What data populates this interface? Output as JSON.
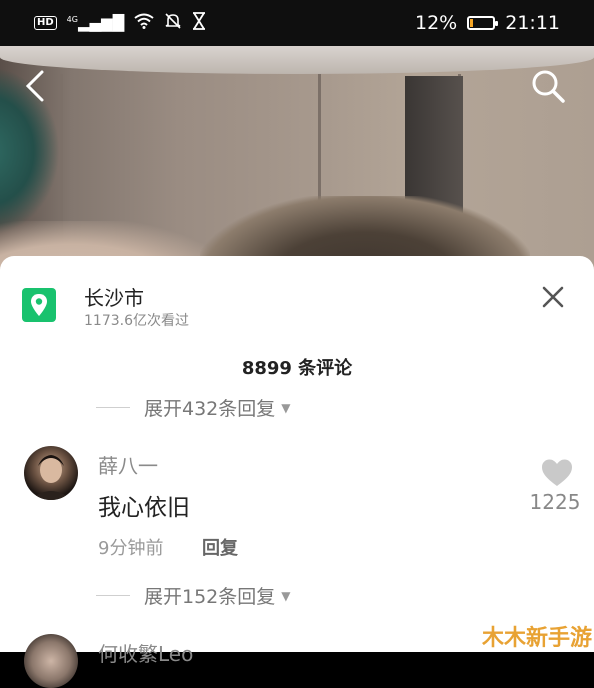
{
  "status_bar": {
    "hd": "HD",
    "network": "4G",
    "battery_percent_text": "12%",
    "battery_level": 0.12,
    "time": "21:11",
    "icons": [
      "hd-icon",
      "signal-icon",
      "wifi-icon",
      "mute-icon",
      "hourglass-icon",
      "battery-icon"
    ]
  },
  "video": {
    "back_icon": "back-arrow-icon",
    "search_icon": "search-icon"
  },
  "location": {
    "icon": "location-pin-icon",
    "city": "长沙市",
    "views": "1173.6亿次看过",
    "close_icon": "close-icon"
  },
  "comments": {
    "count_label": "8899 条评论",
    "expand_top": "展开432条回复",
    "items": [
      {
        "author": "薛八一",
        "text": "我心依旧",
        "time": "9分钟前",
        "reply_label": "回复",
        "likes": "1225"
      }
    ],
    "expand_bottom": "展开152条回复",
    "next_author_partial": "何收繁Leo"
  },
  "watermark": "木木新手游",
  "colors": {
    "location_green": "#19c26e",
    "battery_orange": "#f5a524",
    "watermark_orange": "#e8a233"
  }
}
